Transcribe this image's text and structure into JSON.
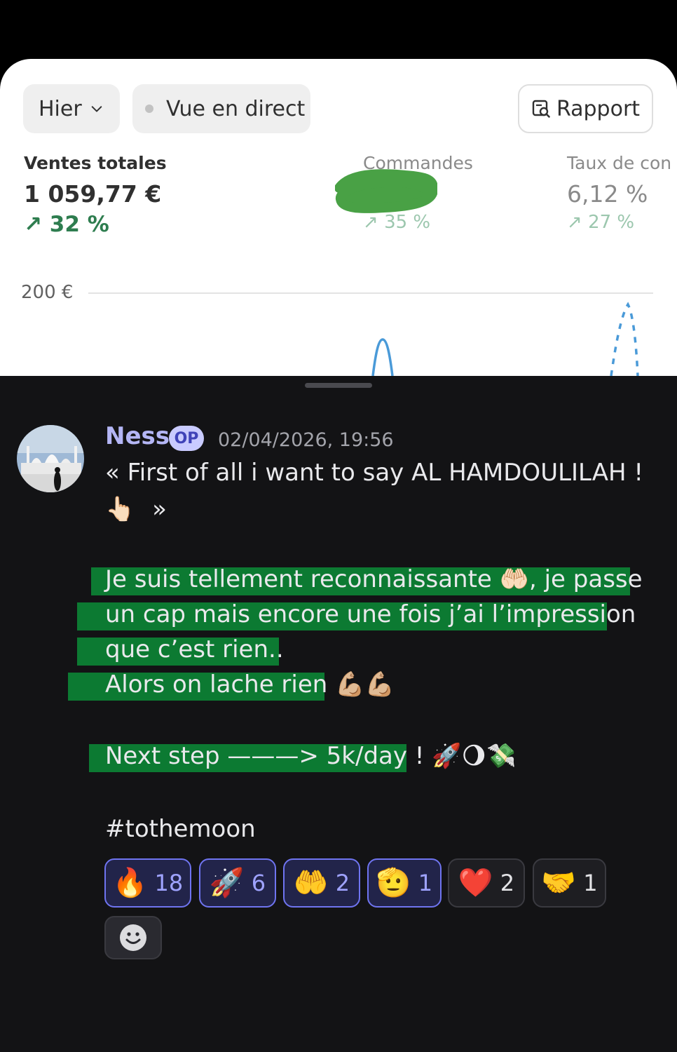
{
  "shop": {
    "date_filter": "Hier",
    "live_view_label": "Vue en direct",
    "report_button": "Rapport",
    "metrics": [
      {
        "label": "Ventes totales",
        "value": "1 059,77 €",
        "change": "32 %"
      },
      {
        "label": "Commandes",
        "value": "",
        "change": "35 %"
      },
      {
        "label": "Taux de con",
        "value": "6,12 %",
        "change": "27 %"
      }
    ],
    "axis_label": "200 €",
    "colors": {
      "positive": "#2e7d4f",
      "series": "#4a9ad8"
    }
  },
  "message": {
    "author": "Ness",
    "badge": "OP",
    "timestamp": "02/04/2026, 19:56",
    "quote_line1": "« First of all i want to say AL HAMDOULILAH !",
    "quote_line2_emoji": "👆🏻",
    "quote_close": "»",
    "body_lines": [
      "Je suis tellement reconnaissante 🤲🏻, je passe",
      "un cap mais encore une fois j’ai l’impression",
      "que c’est rien..",
      "Alors on lache rien 💪🏼💪🏼"
    ],
    "next_step": "Next step ———> 5k/day ! 🚀🌖💸",
    "hashtag": "#tothemoon",
    "reactions": [
      {
        "emoji": "🔥",
        "count": "18"
      },
      {
        "emoji": "🚀",
        "count": "6"
      },
      {
        "emoji": "🤲",
        "count": "2"
      },
      {
        "emoji": "🫡",
        "count": "1"
      },
      {
        "emoji": "❤️",
        "count": "2"
      },
      {
        "emoji": "🤝",
        "count": "1"
      }
    ],
    "highlight_color": "#0c7a32"
  }
}
